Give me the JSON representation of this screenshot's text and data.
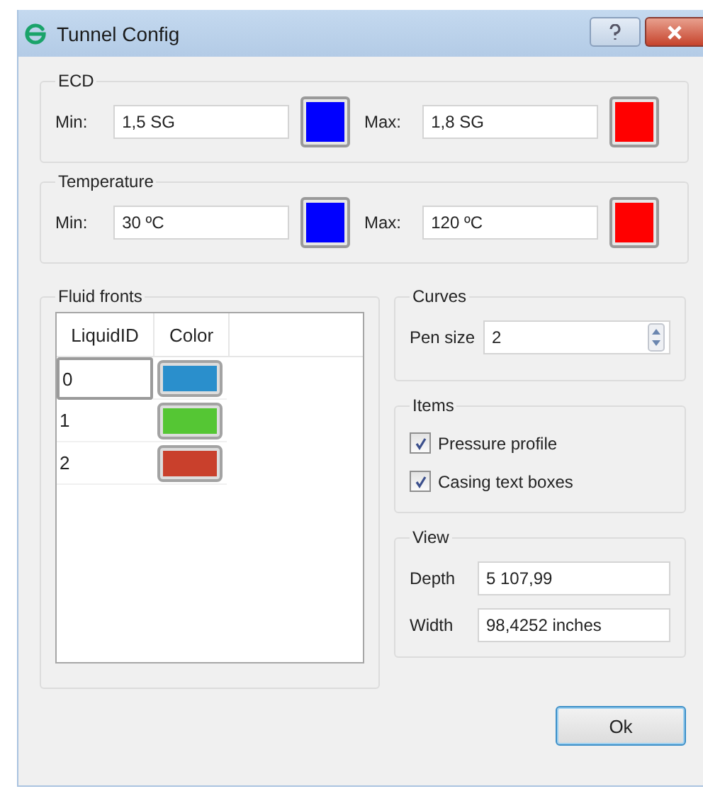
{
  "window": {
    "title": "Tunnel Config"
  },
  "ranges": [
    {
      "title": "ECD",
      "min": {
        "label": "Min:",
        "value": "1,5 SG",
        "color": "#0000ff"
      },
      "max": {
        "label": "Max:",
        "value": "1,8 SG",
        "color": "#ff0000"
      }
    },
    {
      "title": "Temperature",
      "min": {
        "label": "Min:",
        "value": "30 ºC",
        "color": "#0000ff"
      },
      "max": {
        "label": "Max:",
        "value": "120 ºC",
        "color": "#ff0000"
      }
    }
  ],
  "fluid_fronts": {
    "title": "Fluid fronts",
    "columns": [
      "LiquidID",
      "Color"
    ],
    "rows": [
      {
        "id": "0",
        "color": "#2a8fcc",
        "selected": true
      },
      {
        "id": "1",
        "color": "#55c634",
        "selected": false
      },
      {
        "id": "2",
        "color": "#c9402c",
        "selected": false
      }
    ]
  },
  "curves": {
    "title": "Curves",
    "label": "Pen size",
    "value": "2"
  },
  "items": {
    "title": "Items",
    "options": [
      {
        "label": "Pressure profile",
        "checked": true
      },
      {
        "label": "Casing text boxes",
        "checked": true
      }
    ]
  },
  "view": {
    "title": "View",
    "fields": [
      {
        "label": "Depth",
        "value": "5 107,99"
      },
      {
        "label": "Width",
        "value": "98,4252 inches"
      }
    ]
  },
  "buttons": [
    "Ok"
  ]
}
